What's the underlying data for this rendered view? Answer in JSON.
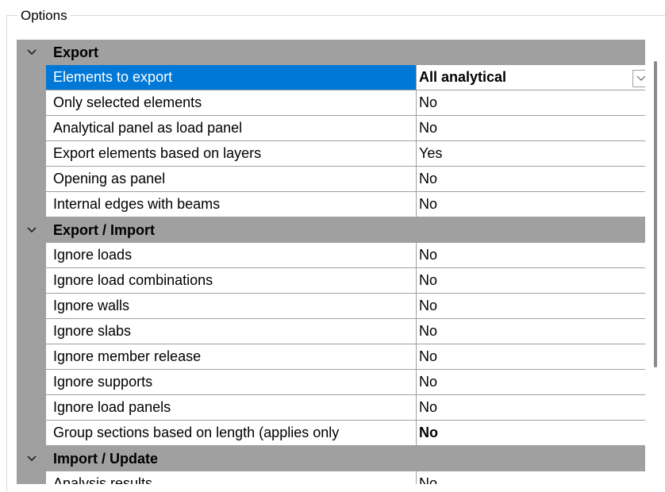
{
  "groupbox": {
    "title": "Options"
  },
  "categories": [
    {
      "label": "Export",
      "rows": [
        {
          "name": "Elements to export",
          "value": "All analytical",
          "selected": true,
          "bold": true,
          "dropdown": true
        },
        {
          "name": "Only selected elements",
          "value": "No"
        },
        {
          "name": "Analytical panel as load panel",
          "value": "No"
        },
        {
          "name": "Export elements based on layers",
          "value": "Yes"
        },
        {
          "name": "Opening as panel",
          "value": "No"
        },
        {
          "name": "Internal edges with beams",
          "value": "No"
        }
      ]
    },
    {
      "label": "Export / Import",
      "rows": [
        {
          "name": "Ignore loads",
          "value": "No"
        },
        {
          "name": "Ignore load combinations",
          "value": "No"
        },
        {
          "name": "Ignore walls",
          "value": "No"
        },
        {
          "name": "Ignore slabs",
          "value": "No"
        },
        {
          "name": "Ignore member release",
          "value": "No"
        },
        {
          "name": "Ignore supports",
          "value": "No"
        },
        {
          "name": "Ignore load panels",
          "value": "No"
        },
        {
          "name": "Group sections based on length (applies only",
          "value": "No",
          "bold": true
        }
      ]
    },
    {
      "label": "Import / Update",
      "rows": [
        {
          "name": "Analysis results",
          "value": "No"
        }
      ]
    }
  ],
  "colors": {
    "selection": "#0078d7",
    "gutter": "#a0a0a0"
  },
  "icons": {
    "collapse": "chevron-down-icon",
    "dropdown": "dropdown-arrow-icon"
  }
}
